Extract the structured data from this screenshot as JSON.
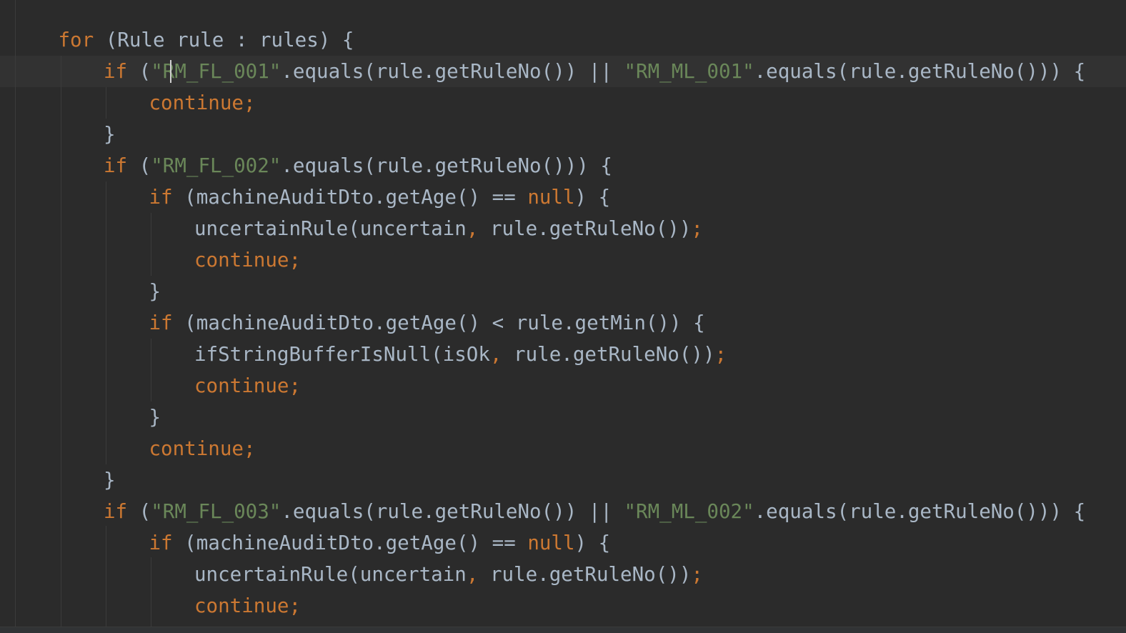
{
  "lines": [
    {
      "indent": 1,
      "tokens": [
        {
          "t": "kw",
          "v": "for "
        },
        {
          "t": "pl",
          "v": "(Rule rule : rules) {"
        }
      ]
    },
    {
      "indent": 2,
      "current": true,
      "tokens": [
        {
          "t": "kw",
          "v": "if "
        },
        {
          "t": "pl",
          "v": "("
        },
        {
          "t": "str",
          "v": "\"RM_FL_001\""
        },
        {
          "t": "pl",
          "v": ".equals(rule.getRuleNo()) || "
        },
        {
          "t": "str",
          "v": "\"RM_ML_001\""
        },
        {
          "t": "pl",
          "v": ".equals(rule.getRuleNo())) {"
        }
      ]
    },
    {
      "indent": 3,
      "tokens": [
        {
          "t": "kw",
          "v": "continue;"
        }
      ]
    },
    {
      "indent": 2,
      "tokens": [
        {
          "t": "pl",
          "v": "}"
        }
      ]
    },
    {
      "indent": 2,
      "tokens": [
        {
          "t": "kw",
          "v": "if "
        },
        {
          "t": "pl",
          "v": "("
        },
        {
          "t": "str",
          "v": "\"RM_FL_002\""
        },
        {
          "t": "pl",
          "v": ".equals(rule.getRuleNo())) {"
        }
      ]
    },
    {
      "indent": 3,
      "tokens": [
        {
          "t": "kw",
          "v": "if "
        },
        {
          "t": "pl",
          "v": "(machineAuditDto.getAge() == "
        },
        {
          "t": "kw",
          "v": "null"
        },
        {
          "t": "pl",
          "v": ") {"
        }
      ]
    },
    {
      "indent": 4,
      "tokens": [
        {
          "t": "pl",
          "v": "uncertainRule(uncertain"
        },
        {
          "t": "kw",
          "v": ", "
        },
        {
          "t": "pl",
          "v": "rule.getRuleNo())"
        },
        {
          "t": "kw",
          "v": ";"
        }
      ]
    },
    {
      "indent": 4,
      "tokens": [
        {
          "t": "kw",
          "v": "continue;"
        }
      ]
    },
    {
      "indent": 3,
      "tokens": [
        {
          "t": "pl",
          "v": "}"
        }
      ]
    },
    {
      "indent": 3,
      "tokens": [
        {
          "t": "kw",
          "v": "if "
        },
        {
          "t": "pl",
          "v": "(machineAuditDto.getAge() < rule.getMin()) {"
        }
      ]
    },
    {
      "indent": 4,
      "tokens": [
        {
          "t": "pl",
          "v": "ifStringBufferIsNull(isOk"
        },
        {
          "t": "kw",
          "v": ", "
        },
        {
          "t": "pl",
          "v": "rule.getRuleNo())"
        },
        {
          "t": "kw",
          "v": ";"
        }
      ]
    },
    {
      "indent": 4,
      "tokens": [
        {
          "t": "kw",
          "v": "continue;"
        }
      ]
    },
    {
      "indent": 3,
      "tokens": [
        {
          "t": "pl",
          "v": "}"
        }
      ]
    },
    {
      "indent": 3,
      "tokens": [
        {
          "t": "kw",
          "v": "continue;"
        }
      ]
    },
    {
      "indent": 2,
      "tokens": [
        {
          "t": "pl",
          "v": "}"
        }
      ]
    },
    {
      "indent": 2,
      "tokens": [
        {
          "t": "kw",
          "v": "if "
        },
        {
          "t": "pl",
          "v": "("
        },
        {
          "t": "str",
          "v": "\"RM_FL_003\""
        },
        {
          "t": "pl",
          "v": ".equals(rule.getRuleNo()) || "
        },
        {
          "t": "str",
          "v": "\"RM_ML_002\""
        },
        {
          "t": "pl",
          "v": ".equals(rule.getRuleNo())) {"
        }
      ]
    },
    {
      "indent": 3,
      "tokens": [
        {
          "t": "kw",
          "v": "if "
        },
        {
          "t": "pl",
          "v": "(machineAuditDto.getAge() == "
        },
        {
          "t": "kw",
          "v": "null"
        },
        {
          "t": "pl",
          "v": ") {"
        }
      ]
    },
    {
      "indent": 4,
      "tokens": [
        {
          "t": "pl",
          "v": "uncertainRule(uncertain"
        },
        {
          "t": "kw",
          "v": ", "
        },
        {
          "t": "pl",
          "v": "rule.getRuleNo())"
        },
        {
          "t": "kw",
          "v": ";"
        }
      ]
    },
    {
      "indent": 4,
      "tokens": [
        {
          "t": "kw",
          "v": "continue;"
        }
      ]
    }
  ],
  "colors": {
    "background": "#2b2b2b",
    "keyword": "#cc7832",
    "string": "#6a8759",
    "plain": "#a9b7c6",
    "current_line": "#323232"
  }
}
